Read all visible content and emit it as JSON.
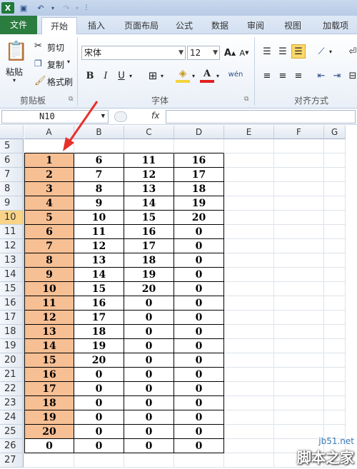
{
  "quick_access": {
    "app_icon": "excel-logo",
    "icons": [
      "save-icon",
      "undo-icon",
      "redo-icon",
      "customize-icon"
    ]
  },
  "tabs": [
    "文件",
    "开始",
    "插入",
    "页面布局",
    "公式",
    "数据",
    "审阅",
    "视图",
    "加载项"
  ],
  "ribbon": {
    "clipboard": {
      "paste": "粘贴",
      "cut": "剪切",
      "copy": "复制",
      "format_painter": "格式刷",
      "group": "剪贴板"
    },
    "font": {
      "name": "宋体",
      "size": "12",
      "bold": "B",
      "italic": "I",
      "underline": "U",
      "group": "字体",
      "grow": "A",
      "shrink": "A",
      "phonetic": "wén"
    },
    "alignment": {
      "group": "对齐方式"
    }
  },
  "formula_bar": {
    "name_box": "N10",
    "fx": "fx"
  },
  "columns": [
    "A",
    "B",
    "C",
    "D",
    "E",
    "F",
    "G"
  ],
  "rows": [
    5,
    6,
    7,
    8,
    9,
    10,
    11,
    12,
    13,
    14,
    15,
    16,
    17,
    18,
    19,
    20,
    21,
    22,
    23,
    24,
    25,
    26,
    27
  ],
  "active_row": 10,
  "cells": [
    [
      "",
      "",
      "",
      ""
    ],
    [
      "1",
      "6",
      "11",
      "16"
    ],
    [
      "2",
      "7",
      "12",
      "17"
    ],
    [
      "3",
      "8",
      "13",
      "18"
    ],
    [
      "4",
      "9",
      "14",
      "19"
    ],
    [
      "5",
      "10",
      "15",
      "20"
    ],
    [
      "6",
      "11",
      "16",
      "0"
    ],
    [
      "7",
      "12",
      "17",
      "0"
    ],
    [
      "8",
      "13",
      "18",
      "0"
    ],
    [
      "9",
      "14",
      "19",
      "0"
    ],
    [
      "10",
      "15",
      "20",
      "0"
    ],
    [
      "11",
      "16",
      "0",
      "0"
    ],
    [
      "12",
      "17",
      "0",
      "0"
    ],
    [
      "13",
      "18",
      "0",
      "0"
    ],
    [
      "14",
      "19",
      "0",
      "0"
    ],
    [
      "15",
      "20",
      "0",
      "0"
    ],
    [
      "16",
      "0",
      "0",
      "0"
    ],
    [
      "17",
      "0",
      "0",
      "0"
    ],
    [
      "18",
      "0",
      "0",
      "0"
    ],
    [
      "19",
      "0",
      "0",
      "0"
    ],
    [
      "20",
      "0",
      "0",
      "0"
    ],
    [
      "0",
      "0",
      "0",
      "0"
    ],
    [
      "",
      "",
      "",
      ""
    ]
  ],
  "watermark": {
    "site": "jb51.net",
    "brand": "脚本之家"
  },
  "colors": {
    "highlight": "#f6bf94",
    "arrow": "#e8302a",
    "file_tab": "#2a7c3f"
  }
}
